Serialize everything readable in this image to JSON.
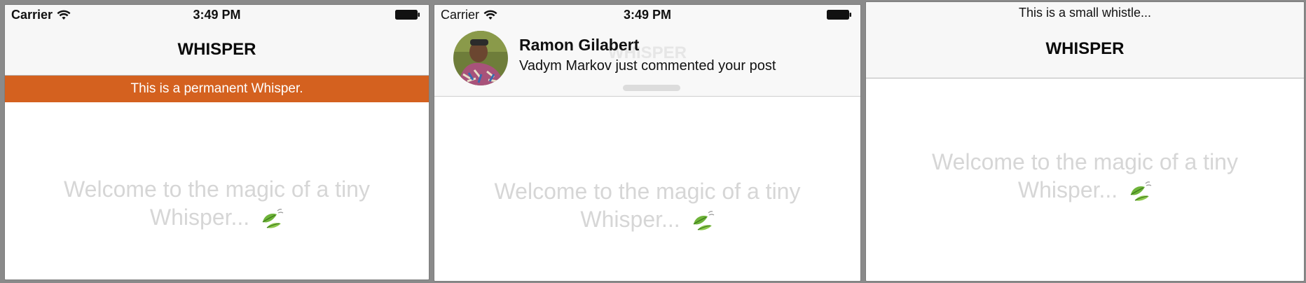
{
  "colors": {
    "banner_bg": "#d4611f",
    "welcome_text": "#d6d6d6"
  },
  "panels": [
    {
      "status": {
        "carrier": "Carrier",
        "time": "3:49 PM"
      },
      "nav_title": "WHISPER",
      "banner_text": "This is a permanent Whisper.",
      "welcome_line1": "Welcome to the magic of a tiny",
      "welcome_line2": "Whisper..."
    },
    {
      "status": {
        "carrier": "Carrier",
        "time": "3:49 PM"
      },
      "nav_title": "WHISPER",
      "notification": {
        "title": "Ramon Gilabert",
        "message": "Vadym Markov just commented your post"
      },
      "welcome_line1": "Welcome to the magic of a tiny",
      "welcome_line2": "Whisper..."
    },
    {
      "whistle_text": "This is a small whistle...",
      "nav_title": "WHISPER",
      "welcome_line1": "Welcome to the magic of a tiny",
      "welcome_line2": "Whisper..."
    }
  ],
  "icons": {
    "signal": "wifi-icon",
    "battery": "battery-icon",
    "leaf": "leaf-icon",
    "avatar": "avatar"
  }
}
